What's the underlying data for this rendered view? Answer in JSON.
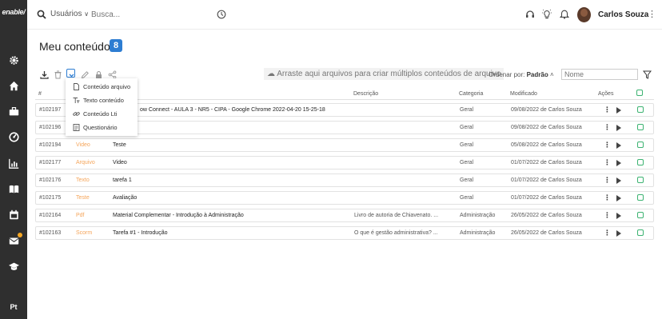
{
  "sidebar": {
    "logo": "enable/",
    "language": "Pt",
    "items": [
      {
        "icon": "gear-icon"
      },
      {
        "icon": "home-icon"
      },
      {
        "icon": "briefcase-icon"
      },
      {
        "icon": "dashboard-icon"
      },
      {
        "icon": "chart-icon"
      },
      {
        "icon": "book-icon"
      },
      {
        "icon": "calendar-icon"
      },
      {
        "icon": "mail-icon"
      },
      {
        "icon": "graduation-icon"
      }
    ],
    "notification_color": "#f5a623"
  },
  "topbar": {
    "search_scope": "Usuários",
    "search_placeholder": "Busca...",
    "user_name": "Carlos Souza"
  },
  "main": {
    "title": "Meu conteúdo",
    "count": "8",
    "dropzone": "Arraste aqui arquivos para criar múltiplos conteúdos de arquivo",
    "sort_label": "Ordenar por:",
    "sort_value": "Padrão",
    "name_placeholder": "Nome",
    "accent": "#2d7dd2"
  },
  "dropdown": {
    "items": [
      {
        "label": "Conteúdo arquivo",
        "icon": "file-icon"
      },
      {
        "label": "Texto conteúdo",
        "icon": "text-icon"
      },
      {
        "label": "Conteúdo Lti",
        "icon": "link-icon"
      },
      {
        "label": "Questionário",
        "icon": "quiz-icon"
      }
    ]
  },
  "table": {
    "headers": {
      "id": "#",
      "description": "Descrição",
      "category": "Categoria",
      "modified": "Modificado",
      "actions": "Ações"
    },
    "rows": [
      {
        "id": "#102197",
        "type": "",
        "title": "ow Connect - AULA 3 - NR5 - CIPA - Google Chrome 2022-04-20 15-25-18",
        "description": "",
        "category": "Geral",
        "modified": "09/08/2022 de Carlos Souza"
      },
      {
        "id": "#102196",
        "type": "",
        "title": "",
        "description": "",
        "category": "Geral",
        "modified": "09/08/2022 de Carlos Souza"
      },
      {
        "id": "#102194",
        "type": "Video",
        "title": "Teste",
        "description": "",
        "category": "Geral",
        "modified": "05/08/2022 de Carlos Souza"
      },
      {
        "id": "#102177",
        "type": "Arquivo",
        "title": "Video",
        "description": "",
        "category": "Geral",
        "modified": "01/07/2022 de Carlos Souza"
      },
      {
        "id": "#102176",
        "type": "Texto",
        "title": "tarefa 1",
        "description": "",
        "category": "Geral",
        "modified": "01/07/2022 de Carlos Souza"
      },
      {
        "id": "#102175",
        "type": "Teste",
        "title": "Avaliação",
        "description": "",
        "category": "Geral",
        "modified": "01/07/2022 de Carlos Souza"
      },
      {
        "id": "#102164",
        "type": "Pdf",
        "title": "Material Complementar - Introdução à Administração",
        "description": "Livro de autoria de Chiavenato. ...",
        "category": "Administração",
        "modified": "26/05/2022 de Carlos Souza"
      },
      {
        "id": "#102163",
        "type": "Scorm",
        "title": "Tarefa #1 - Introdução",
        "description": "O que é gestão administrativa? ...",
        "category": "Administração",
        "modified": "26/05/2022 de Carlos Souza"
      }
    ]
  }
}
